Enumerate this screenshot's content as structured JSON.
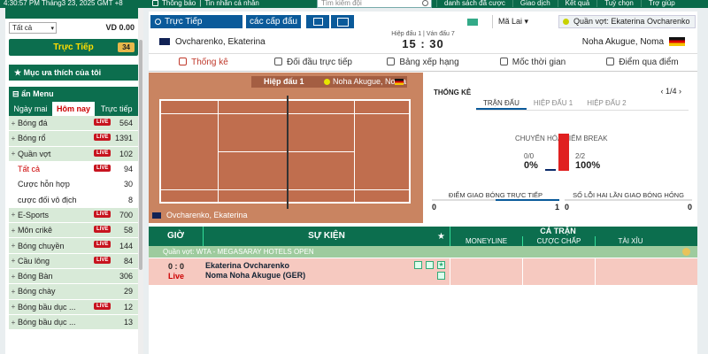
{
  "topbar": {
    "time": "4:30:57 PM Tháng3 23, 2025 GMT +8",
    "notice": "Thông báo",
    "personal": "Tin nhắn cá nhân",
    "search_placeholder": "Tìm kiếm đội",
    "links": [
      "danh sách đã cược",
      "Giao dịch",
      "Kết quả",
      "Tuỳ chọn",
      "Trợ giúp"
    ]
  },
  "sidebar": {
    "select": "Tất cả",
    "balance": "VD 0.00",
    "live_label": "Trực Tiếp",
    "live_count": "34",
    "favorites": "Mục ưa thích của tôi",
    "menu": "ẩn Menu",
    "tabs": [
      "Ngày mai",
      "Hôm nay",
      "Trực tiếp"
    ],
    "items": [
      {
        "name": "Bóng đá",
        "live": "LIVE",
        "count": "564"
      },
      {
        "name": "Bóng rổ",
        "live": "LIVE",
        "count": "1391"
      },
      {
        "name": "Quần vợt",
        "live": "LIVE",
        "count": "102"
      },
      {
        "name": "Tất cả",
        "live": "LIVE",
        "count": "94",
        "sub": true,
        "active": true
      },
      {
        "name": "Cược hỗn hợp",
        "live": "",
        "count": "30",
        "sub": true
      },
      {
        "name": "cược đối vô địch",
        "live": "",
        "count": "8",
        "sub": true
      },
      {
        "name": "E-Sports",
        "live": "LIVE",
        "count": "700"
      },
      {
        "name": "Môn crikê",
        "live": "LIVE",
        "count": "58"
      },
      {
        "name": "Bóng chuyền",
        "live": "LIVE",
        "count": "144"
      },
      {
        "name": "Cầu lông",
        "live": "LIVE",
        "count": "84"
      },
      {
        "name": "Bóng Bàn",
        "live": "",
        "count": "306"
      },
      {
        "name": "Bóng chày",
        "live": "",
        "count": "29"
      },
      {
        "name": "Bóng bầu dục ...",
        "live": "LIVE",
        "count": "12"
      },
      {
        "name": "Bóng bầu dục ...",
        "live": "",
        "count": "13"
      }
    ]
  },
  "header": {
    "live_tab": "Trực Tiếp",
    "level_tab": "các cấp đấu",
    "odds_select": "Mã Lai",
    "player_select": "Quần vợt: Ekaterina Ovcharenko"
  },
  "match": {
    "player1": "Ovcharenko, Ekaterina",
    "player2": "Noha Akugue, Noma",
    "set_info": "Hiệp đấu 1 | Ván đấu 7",
    "score": "15 : 30"
  },
  "nav_tabs": [
    "Thống kê",
    "Đối đầu trực tiếp",
    "Bảng xếp hạng",
    "Mốc thời gian",
    "Điểm qua điểm"
  ],
  "court": {
    "set_label": "Hiệp đấu 1",
    "serving_player": "Noha Akugue, Noma",
    "bottom_player": "Ovcharenko, Ekaterina"
  },
  "stats": {
    "title": "THỐNG KÊ",
    "pager": "1/4",
    "subtabs": [
      "TRẬN ĐẤU",
      "HIỆP ĐẤU 1",
      "HIỆP ĐẤU 2"
    ],
    "break_label": "CHUYỂN HÓA ĐIỂM BREAK",
    "left_ratio": "0/0",
    "left_pct": "0%",
    "right_ratio": "2/2",
    "right_pct": "100%",
    "box1_label": "ĐIỂM GIAO BÓNG TRỰC TIẾP",
    "box1_a": "0",
    "box1_b": "1",
    "box2_label": "SỐ LỖI HAI LẦN GIAO BÓNG HỎNG",
    "box2_a": "0",
    "box2_b": "0"
  },
  "events": {
    "col_time": "GIỜ",
    "col_event": "SỰ KIỆN",
    "col_full": "CẢ TRẬN",
    "sub_cols": [
      "MONEYLINE",
      "CƯỢC CHẤP",
      "TÀI XỈU"
    ],
    "league": "Quần vợt: WTA - MEGASARAY HOTELS OPEN",
    "row": {
      "score": "0 : 0",
      "status": "Live",
      "team1": "Ekaterina Ovcharenko",
      "team2": "Noma Noha Akugue (GER)"
    }
  },
  "colors": {
    "brand_green": "#0a6a4a",
    "live_red": "#c7141f",
    "tab_blue": "#0a5a9a"
  }
}
